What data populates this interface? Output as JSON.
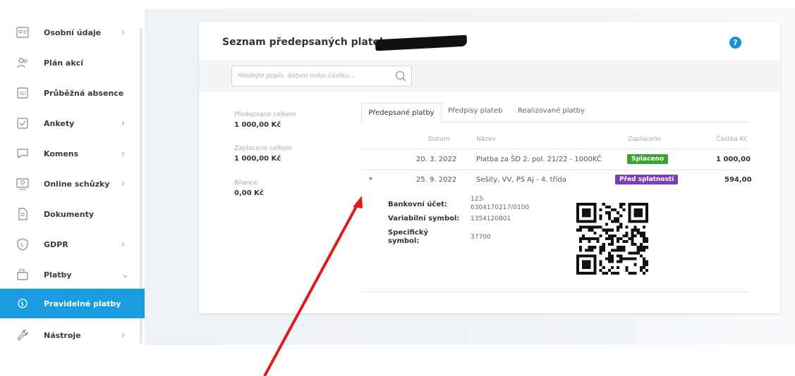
{
  "sidebar": {
    "items": [
      {
        "label": "Osobní údaje",
        "icon": "person-card-icon",
        "chevron": "›"
      },
      {
        "label": "Plán akcí",
        "icon": "people-icon",
        "chevron": ""
      },
      {
        "label": "Průběžná absence",
        "icon": "absence-icon",
        "chevron": ""
      },
      {
        "label": "Ankety",
        "icon": "check-box-icon",
        "chevron": "›"
      },
      {
        "label": "Komens",
        "icon": "chat-icon",
        "chevron": "›"
      },
      {
        "label": "Online schůzky",
        "icon": "video-icon",
        "chevron": "›"
      },
      {
        "label": "Dokumenty",
        "icon": "document-icon",
        "chevron": ""
      },
      {
        "label": "GDPR",
        "icon": "shield-icon",
        "chevron": "›"
      },
      {
        "label": "Platby",
        "icon": "wallet-icon",
        "chevron": "⌄"
      },
      {
        "label": "Pravidelné platby",
        "icon": "recurring-payment-icon",
        "chevron": ""
      },
      {
        "label": "Nástroje",
        "icon": "wrench-icon",
        "chevron": "›"
      }
    ],
    "active_color": "#1a9de0"
  },
  "card": {
    "title": "Seznam předepsaných plateb –",
    "help": "?",
    "search_placeholder": "Hledejte popis, datum nebo částku..."
  },
  "summary": {
    "prescribed_label": "Předepsáno celkem",
    "prescribed_value": "1 000,00 Kč",
    "paid_label": "Zaplaceno celkem",
    "paid_value": "1 000,00 Kč",
    "balance_label": "Bilance",
    "balance_value": "0,00 Kč"
  },
  "tabs": [
    {
      "label": "Předepsané platby"
    },
    {
      "label": "Předpisy plateb"
    },
    {
      "label": "Realizované platby"
    }
  ],
  "table": {
    "headers": {
      "date": "Datum",
      "name": "Název",
      "paid": "Zaplaceno",
      "amount": "Částka Kč"
    },
    "rows": [
      {
        "expand": "",
        "date": "20. 3. 2022",
        "name": "Platba za ŠD 2. pol. 21/22 - 1000KČ",
        "status": "Splaceno",
        "status_color": "#3aa335",
        "amount": "1 000,00"
      },
      {
        "expand": "▾",
        "date": "25. 9. 2022",
        "name": "Sešity, VV, PS Aj - 4. třída",
        "status": "Před splatností",
        "status_color": "#7b3fb5",
        "amount": "594,00"
      }
    ]
  },
  "detail": {
    "account_label": "Bankovní účet:",
    "account_value_1": "123-",
    "account_value_2": "6304170217/0100",
    "vs_label": "Variabilní symbol:",
    "vs_value": "1354120801",
    "ss_label_1": "Specifický",
    "ss_label_2": "symbol:",
    "ss_value": "37700"
  }
}
